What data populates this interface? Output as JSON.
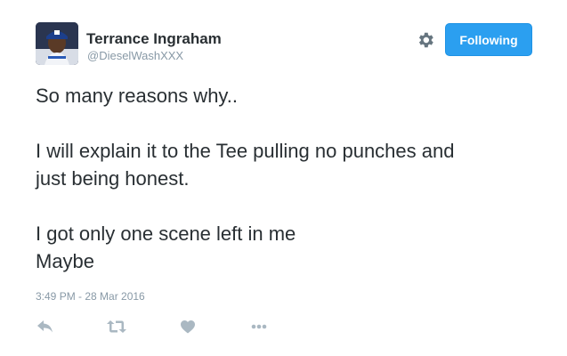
{
  "user": {
    "name": "Terrance Ingraham",
    "handle": "@DieselWashXXX"
  },
  "follow_button": {
    "label": "Following"
  },
  "tweet": {
    "lines": [
      "So many reasons why..",
      "",
      "I will explain it to the Tee pulling no punches and",
      "just being honest.",
      "",
      "I got only one scene left in me",
      "Maybe"
    ],
    "timestamp": "3:49 PM - 28 Mar 2016"
  },
  "icons": {
    "settings": "gear-icon",
    "reply": "reply-icon",
    "retweet": "retweet-icon",
    "like": "heart-icon",
    "more": "more-icon"
  },
  "colors": {
    "accent": "#2b9ff0",
    "text": "#292f33",
    "muted": "#8899a6",
    "icon": "#aab8c2"
  }
}
